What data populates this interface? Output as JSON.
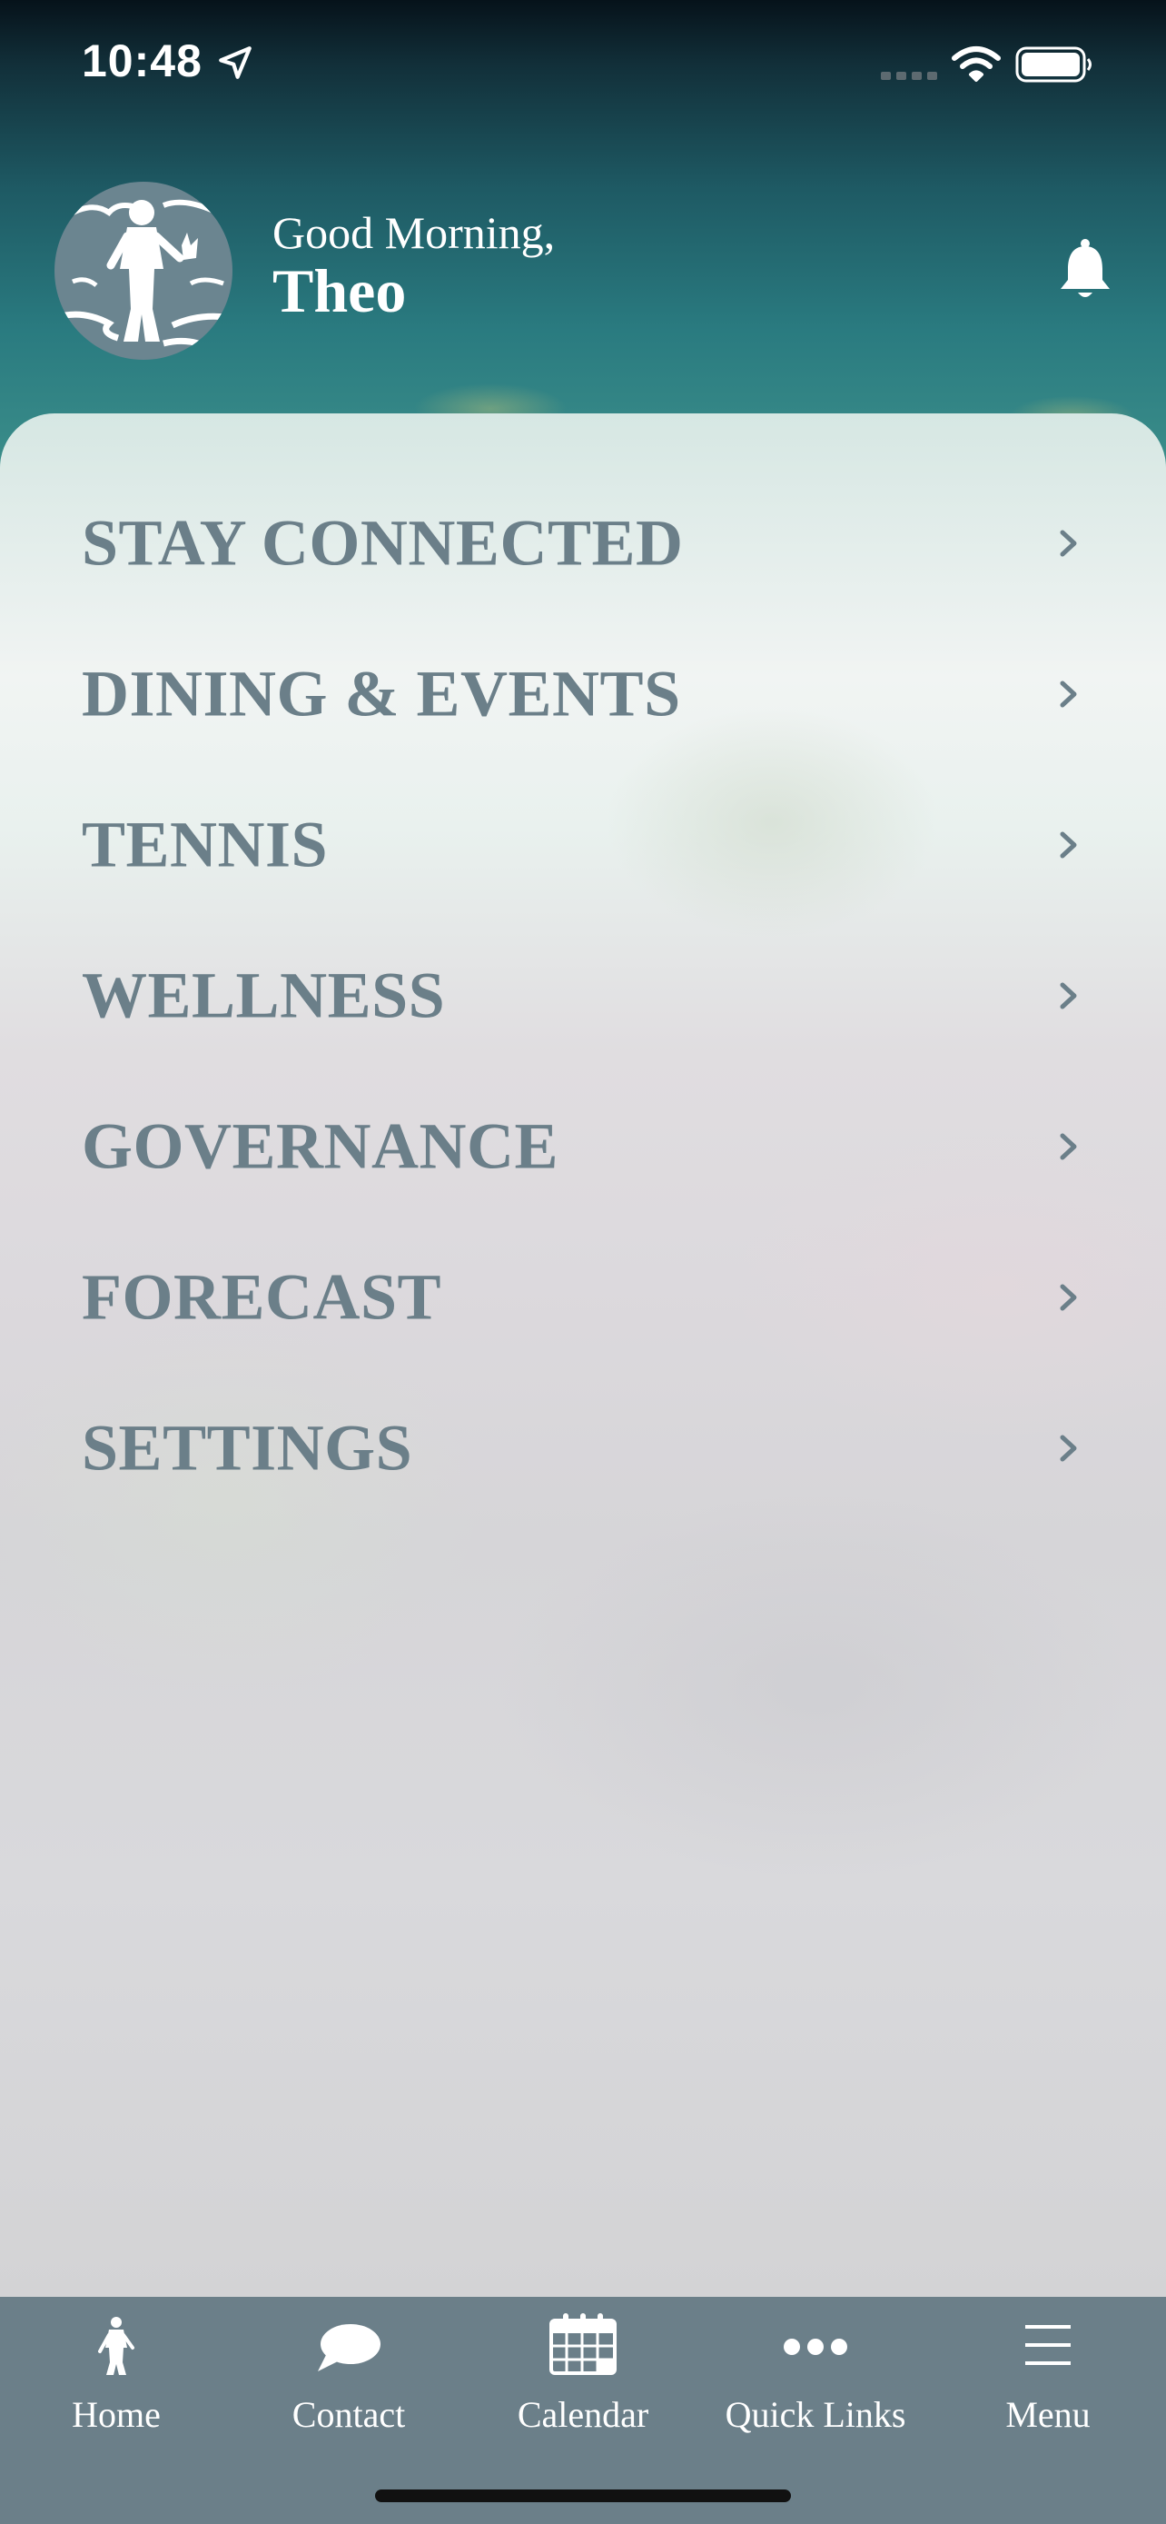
{
  "status_bar": {
    "time": "10:48",
    "icons": [
      "location-arrow-icon",
      "signal-icon",
      "wifi-icon",
      "battery-icon"
    ]
  },
  "header": {
    "greeting": "Good Morning,",
    "user_name": "Theo",
    "avatar_icon": "club-logo-icon",
    "notification_icon": "bell-icon"
  },
  "menu": {
    "items": [
      {
        "label": "STAY CONNECTED"
      },
      {
        "label": "DINING & EVENTS"
      },
      {
        "label": "TENNIS"
      },
      {
        "label": "WELLNESS"
      },
      {
        "label": "GOVERNANCE"
      },
      {
        "label": "FORECAST"
      },
      {
        "label": "SETTINGS"
      }
    ],
    "chevron_icon": "chevron-right-icon",
    "text_color": "#6b7f89"
  },
  "tab_bar": {
    "background": "#6b7f89",
    "tabs": [
      {
        "label": "Home",
        "icon": "figure-logo-icon"
      },
      {
        "label": "Contact",
        "icon": "speech-bubble-icon"
      },
      {
        "label": "Calendar",
        "icon": "calendar-icon"
      },
      {
        "label": "Quick Links",
        "icon": "more-dots-icon"
      },
      {
        "label": "Menu",
        "icon": "hamburger-menu-icon"
      }
    ]
  }
}
